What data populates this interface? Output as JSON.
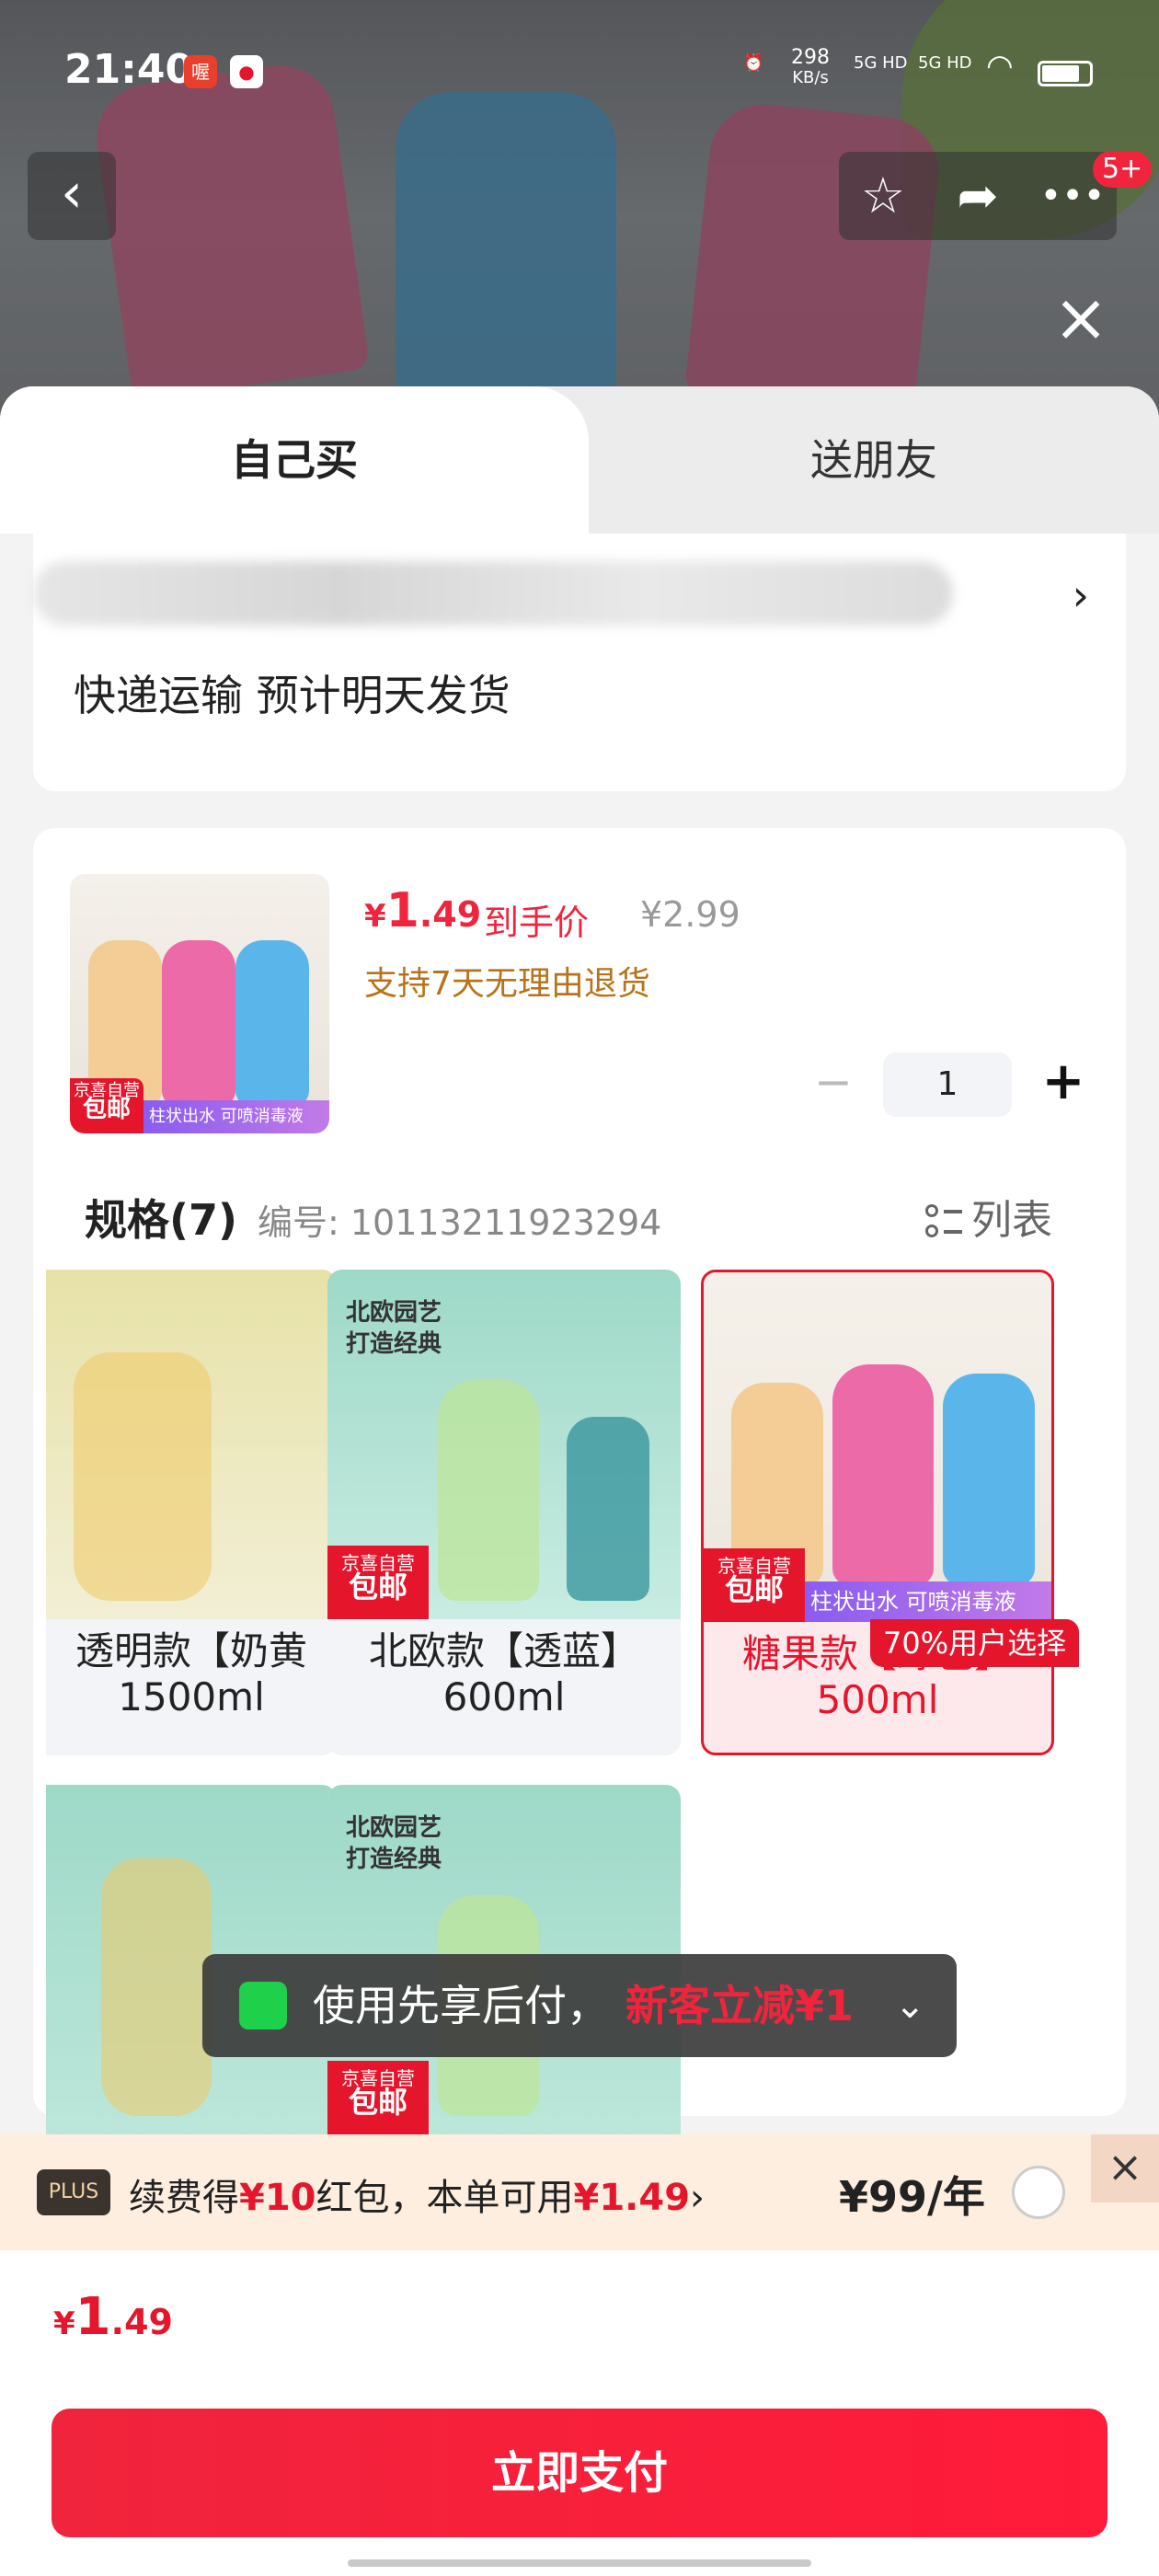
{
  "status_bar": {
    "time": "21:40",
    "net_speed": "298",
    "net_unit": "KB/s",
    "signal1": "5G HD",
    "signal2": "5G HD"
  },
  "header": {
    "back_icon": "back-arrow-icon",
    "star_icon": "star-icon",
    "share_icon": "share-icon",
    "more_icon": "more-icon",
    "badge": "5+"
  },
  "tabs": {
    "self": "自己买",
    "friend": "送朋友"
  },
  "address": {
    "shipping": "快递运输 预计明天发货"
  },
  "product": {
    "price_currency": "¥",
    "price_int": "1",
    "price_dec": ".49",
    "price_label": "到手价",
    "price_original": "¥2.99",
    "return_policy": "支持7天无理由退货",
    "thumb_tag_top": "京喜自营",
    "thumb_tag_bottom": "包邮",
    "thumb_band": "柱状出水 可喷消毒液",
    "quantity": "1"
  },
  "specs": {
    "title": "规格(7)",
    "code": "编号: 10113211923294",
    "list_label": "列表",
    "selected_badge": "70%用户选择",
    "variants": [
      {
        "name": "透明款【奶黄",
        "size": "1500ml"
      },
      {
        "name": "北欧款【透蓝】",
        "size": "600ml",
        "deco1": "北欧园艺",
        "deco2": "打造经典"
      },
      {
        "name": "糖果款【绿色】",
        "size": "500ml"
      }
    ],
    "row2_deco1": "北欧园艺",
    "row2_deco2": "打造经典",
    "tag_top": "京喜自营",
    "tag_bottom": "包邮",
    "band_text": "柱状出水 可喷消毒液"
  },
  "toast": {
    "text": "使用先享后付，",
    "promo": "新客立减¥1"
  },
  "plus_bar": {
    "logo": "PLUS",
    "text_prefix": "续费得",
    "red1": "¥10",
    "text_mid": "红包，本单可用",
    "red2": "¥1.49",
    "arrow": "›",
    "price": "¥99/年"
  },
  "footer": {
    "total_currency": "¥",
    "total_int": "1",
    "total_dec": ".49",
    "pay_button": "立即支付"
  },
  "colors": {
    "accent": "#f0243c",
    "return_policy": "#b8731a",
    "plus_bg": "#fdeedf"
  }
}
